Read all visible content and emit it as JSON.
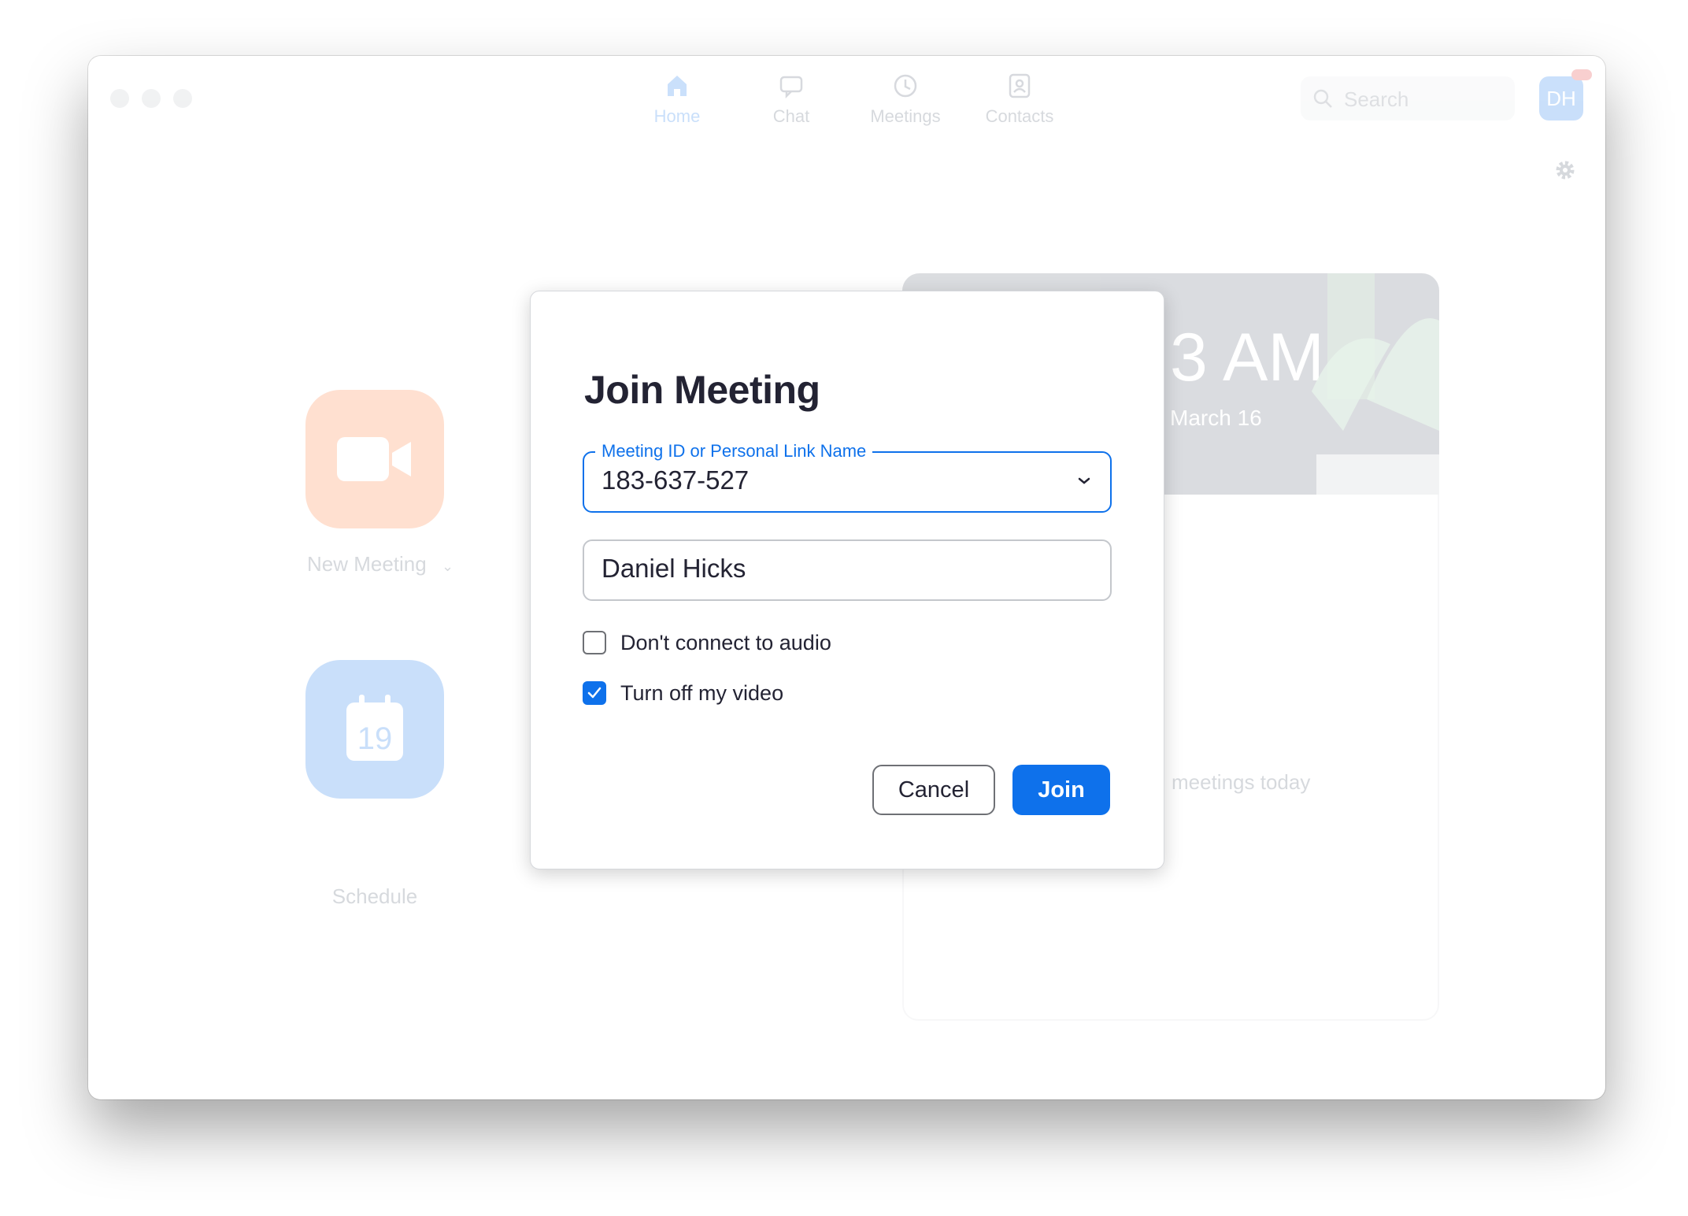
{
  "nav": {
    "items": [
      {
        "label": "Home",
        "icon": "home-icon",
        "active": true
      },
      {
        "label": "Chat",
        "icon": "chat-icon"
      },
      {
        "label": "Meetings",
        "icon": "clock-icon"
      },
      {
        "label": "Contacts",
        "icon": "contacts-icon"
      }
    ],
    "search_placeholder": "Search",
    "avatar_initials": "DH"
  },
  "home": {
    "new_meeting_label": "New Meeting",
    "schedule_label": "Schedule",
    "calendar_day": "19",
    "clock_time": "3 AM",
    "clock_date": "March 16",
    "no_meetings_text": "meetings today"
  },
  "dialog": {
    "title": "Join Meeting",
    "meeting_id_label": "Meeting ID or Personal Link Name",
    "meeting_id_value": "183-637-527",
    "name_value": "Daniel Hicks",
    "option_audio_label": "Don't connect to audio",
    "option_audio_checked": false,
    "option_video_label": "Turn off my video",
    "option_video_checked": true,
    "cancel_label": "Cancel",
    "join_label": "Join"
  },
  "colors": {
    "accent": "#0e71eb",
    "new_meeting": "#ff742e",
    "text": "#232333"
  }
}
